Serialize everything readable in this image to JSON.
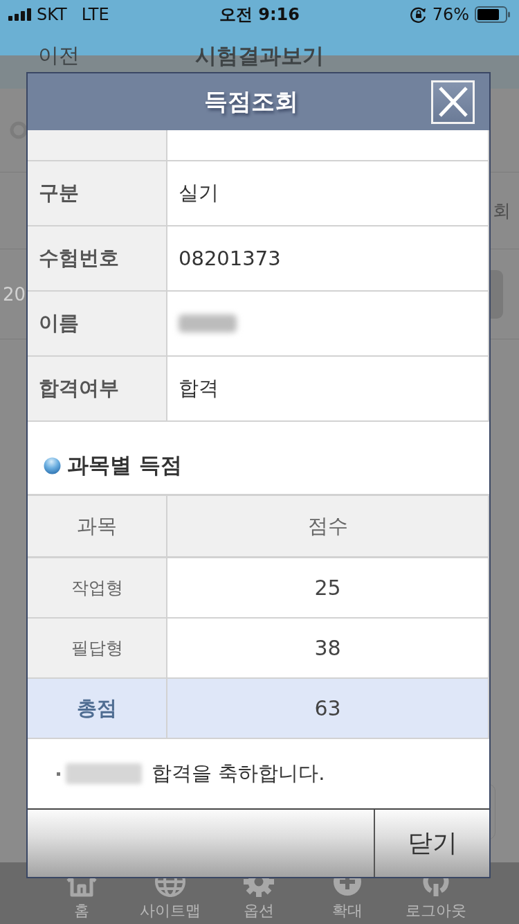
{
  "status_bar": {
    "carrier": "SKT",
    "network": "LTE",
    "time": "오전 9:16",
    "battery": "76%"
  },
  "page": {
    "back": "이전",
    "title": "시험결과보기",
    "table_header_fragment": "회",
    "table_cell_fragment": "20",
    "tab_bar": [
      {
        "kind": "home",
        "label": "홈"
      },
      {
        "kind": "sitemap",
        "label": "사이트맵"
      },
      {
        "kind": "options",
        "label": "옵션"
      },
      {
        "kind": "zoom",
        "label": "확대"
      },
      {
        "kind": "logout",
        "label": "로그아웃"
      }
    ]
  },
  "dialog": {
    "title": "득점조회",
    "first_row_cut": true,
    "info_rows": [
      {
        "label": "구분",
        "value": "실기",
        "redacted": false
      },
      {
        "label": "수험번호",
        "value": "08201373",
        "redacted": false
      },
      {
        "label": "이름",
        "redacted": true
      },
      {
        "label": "합격여부",
        "value": "합격",
        "redacted": false
      }
    ],
    "section_title": "과목별 득점",
    "score_table": {
      "columns": [
        "과목",
        "점수"
      ],
      "rows": [
        {
          "subject": "작업형",
          "score": "25",
          "total": false
        },
        {
          "subject": "필답형",
          "score": "38",
          "total": false
        },
        {
          "subject": "총점",
          "score": "63",
          "total": true
        }
      ]
    },
    "message": {
      "name_redacted": true,
      "text": "합격을 축하합니다."
    },
    "buttons": [
      {
        "kind": "blank"
      },
      {
        "kind": "text",
        "label": "닫기"
      }
    ]
  }
}
